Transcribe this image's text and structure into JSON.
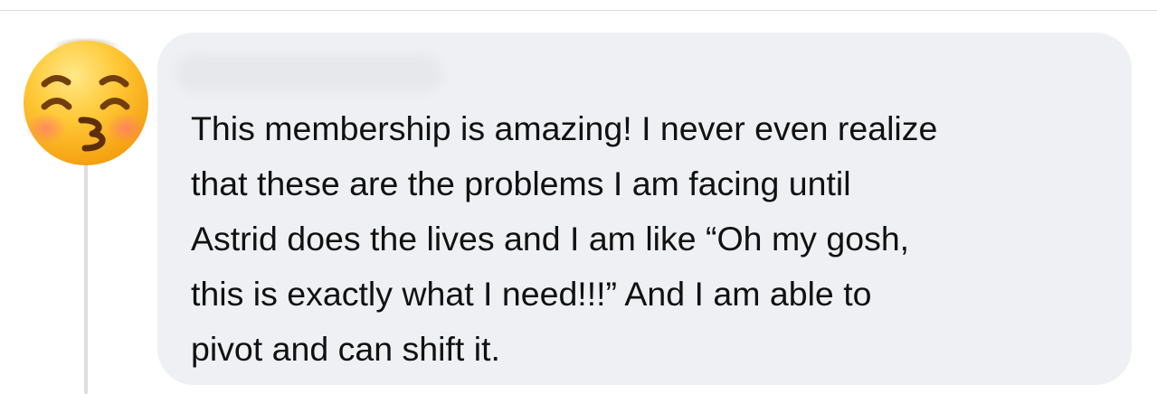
{
  "comment": {
    "lines": [
      "This membership is amazing! I never even realize",
      "that these are the problems I am facing until",
      "Astrid does the lives and I am like “Oh my gosh,",
      "this is exactly what I need!!!” And I am able to",
      "pivot and can shift it."
    ]
  },
  "avatar": {
    "icon": "kissing-face-with-closed-eyes-emoji-icon"
  },
  "colors": {
    "bubble": "#eff0f4",
    "text": "#111111",
    "thread_line": "#dedee2"
  }
}
